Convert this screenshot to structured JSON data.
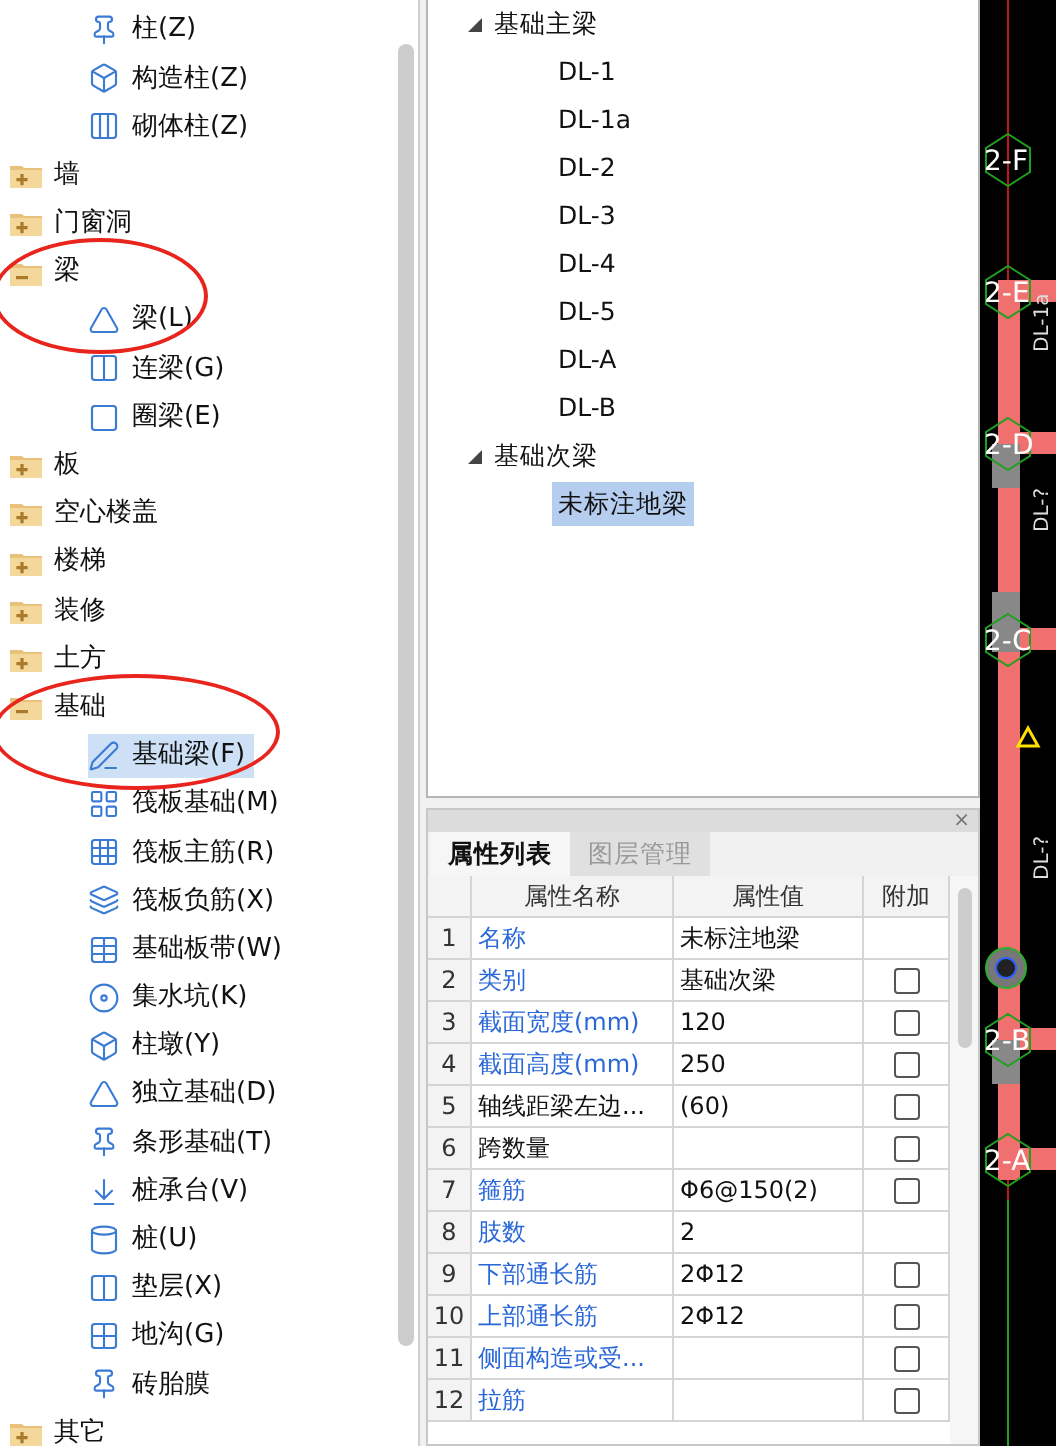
{
  "component_tree": {
    "leading_items": [
      {
        "label": "柱(Z)",
        "selected": false
      },
      {
        "label": "构造柱(Z)",
        "selected": false
      },
      {
        "label": "砌体柱(Z)",
        "selected": false
      }
    ],
    "folders": [
      {
        "label": "墙",
        "expanded": false,
        "circled": false
      },
      {
        "label": "门窗洞",
        "expanded": false,
        "circled": false
      },
      {
        "label": "梁",
        "expanded": true,
        "circled": true,
        "children": [
          {
            "label": "梁(L)",
            "selected": false
          },
          {
            "label": "连梁(G)",
            "selected": false
          },
          {
            "label": "圈梁(E)",
            "selected": false
          }
        ]
      },
      {
        "label": "板",
        "expanded": false,
        "circled": false
      },
      {
        "label": "空心楼盖",
        "expanded": false,
        "circled": false
      },
      {
        "label": "楼梯",
        "expanded": false,
        "circled": false
      },
      {
        "label": "装修",
        "expanded": false,
        "circled": false
      },
      {
        "label": "土方",
        "expanded": false,
        "circled": false
      },
      {
        "label": "基础",
        "expanded": true,
        "circled": true,
        "children": [
          {
            "label": "基础梁(F)",
            "selected": true
          },
          {
            "label": "筏板基础(M)",
            "selected": false
          },
          {
            "label": "筏板主筋(R)",
            "selected": false
          },
          {
            "label": "筏板负筋(X)",
            "selected": false
          },
          {
            "label": "基础板带(W)",
            "selected": false
          },
          {
            "label": "集水坑(K)",
            "selected": false
          },
          {
            "label": "柱墩(Y)",
            "selected": false
          },
          {
            "label": "独立基础(D)",
            "selected": false
          },
          {
            "label": "条形基础(T)",
            "selected": false
          },
          {
            "label": "桩承台(V)",
            "selected": false
          },
          {
            "label": "桩(U)",
            "selected": false
          },
          {
            "label": "垫层(X)",
            "selected": false
          },
          {
            "label": "地沟(G)",
            "selected": false
          },
          {
            "label": "砖胎膜",
            "selected": false
          }
        ]
      },
      {
        "label": "其它",
        "expanded": false,
        "circled": false
      }
    ]
  },
  "element_tree": [
    {
      "label": "基础主梁",
      "expanded": true,
      "children": [
        {
          "label": "DL-1",
          "selected": false
        },
        {
          "label": "DL-1a",
          "selected": false
        },
        {
          "label": "DL-2",
          "selected": false
        },
        {
          "label": "DL-3",
          "selected": false
        },
        {
          "label": "DL-4",
          "selected": false
        },
        {
          "label": "DL-5",
          "selected": false
        },
        {
          "label": "DL-A",
          "selected": false
        },
        {
          "label": "DL-B",
          "selected": false
        }
      ]
    },
    {
      "label": "基础次梁",
      "expanded": true,
      "children": [
        {
          "label": "未标注地梁",
          "selected": true
        }
      ]
    }
  ],
  "properties_panel": {
    "close": "×",
    "tabs": [
      {
        "label": "属性列表",
        "selected": true
      },
      {
        "label": "图层管理",
        "selected": false
      }
    ],
    "columns": [
      "属性名称",
      "属性值",
      "附加"
    ],
    "rows": [
      {
        "index": "1",
        "name": "名称",
        "value": "未标注地梁",
        "kind": "public"
      },
      {
        "index": "2",
        "name": "类别",
        "value": "基础次梁",
        "kind": "public",
        "checked": false
      },
      {
        "index": "3",
        "name": "截面宽度(mm)",
        "value": "120",
        "kind": "public",
        "checked": false
      },
      {
        "index": "4",
        "name": "截面高度(mm)",
        "value": "250",
        "kind": "public",
        "checked": false
      },
      {
        "index": "5",
        "name": "轴线距梁左边...",
        "value": "(60)",
        "kind": "private",
        "checked": false
      },
      {
        "index": "6",
        "name": "跨数量",
        "kind": "private",
        "checked": false
      },
      {
        "index": "7",
        "name": "箍筋",
        "value": "Φ6@150(2)",
        "kind": "public",
        "checked": false
      },
      {
        "index": "8",
        "name": "肢数",
        "value": "2",
        "kind": "public"
      },
      {
        "index": "9",
        "name": "下部通长筋",
        "value": "2Φ12",
        "kind": "public",
        "checked": false
      },
      {
        "index": "10",
        "name": "上部通长筋",
        "value": "2Φ12",
        "kind": "public",
        "checked": false
      },
      {
        "index": "11",
        "name": "侧面构造或受...",
        "kind": "public",
        "checked": false
      },
      {
        "index": "12",
        "name": "拉筋",
        "kind": "public",
        "checked": false
      }
    ]
  },
  "cad_view": {
    "axis_labels": [
      "2-F",
      "2-E",
      "2-D",
      "2-C",
      "2-B",
      "2-A"
    ],
    "beam_labels": [
      "DL-1a",
      "DL-?",
      "DL-?"
    ]
  }
}
